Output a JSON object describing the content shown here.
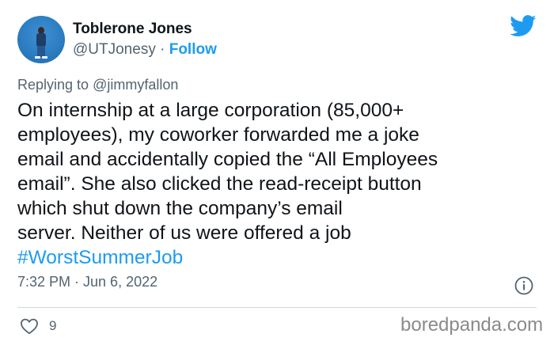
{
  "author": {
    "display_name": "Toblerone Jones",
    "handle": "@UTJonesy",
    "separator": " · ",
    "follow_label": "Follow"
  },
  "reply": {
    "prefix": "Replying to ",
    "handle": "@jimmyfallon"
  },
  "tweet": {
    "lines": [
      "On internship at a large corporation (85,000+",
      "employees), my coworker forwarded me a joke",
      "email and accidentally copied the “All Employees",
      "email”. She also clicked the read-receipt button",
      "which shut down the company’s email",
      "server. Neither of us were offered a job"
    ],
    "hashtag": "#WorstSummerJob"
  },
  "meta": {
    "timestamp": "7:32 PM · Jun 6, 2022"
  },
  "actions": {
    "like_count": "9"
  },
  "watermark": "boredpanda.com",
  "colors": {
    "accent": "#1d9bf0",
    "text": "#0f1419",
    "muted": "#536471"
  },
  "icons": [
    "twitter-bird-icon",
    "info-icon",
    "heart-icon"
  ]
}
